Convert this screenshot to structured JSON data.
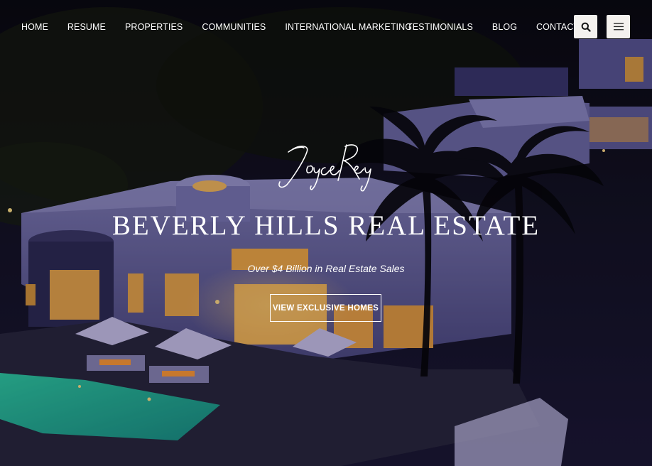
{
  "nav": {
    "left_items": [
      {
        "label": "HOME"
      },
      {
        "label": "RESUME"
      },
      {
        "label": "PROPERTIES"
      },
      {
        "label": "COMMUNITIES"
      },
      {
        "label": "INTERNATIONAL MARKETING"
      }
    ],
    "right_items": [
      {
        "label": "TESTIMONIALS"
      },
      {
        "label": "BLOG"
      },
      {
        "label": "CONTACT"
      }
    ],
    "search_icon": "search-icon",
    "menu_icon": "hamburger-menu-icon"
  },
  "hero": {
    "logo_text": "Joyce Rey",
    "headline": "BEVERLY HILLS REAL ESTATE",
    "tagline": "Over $4 Billion in Real Estate Sales",
    "cta_label": "VIEW EXCLUSIVE HOMES"
  },
  "colors": {
    "night_sky": "#0d0b1a",
    "house_wall": "#8c88c4",
    "window_glow": "#f0a84a",
    "pool": "#3fd8b8",
    "button_bg": "#f4f1ee"
  }
}
